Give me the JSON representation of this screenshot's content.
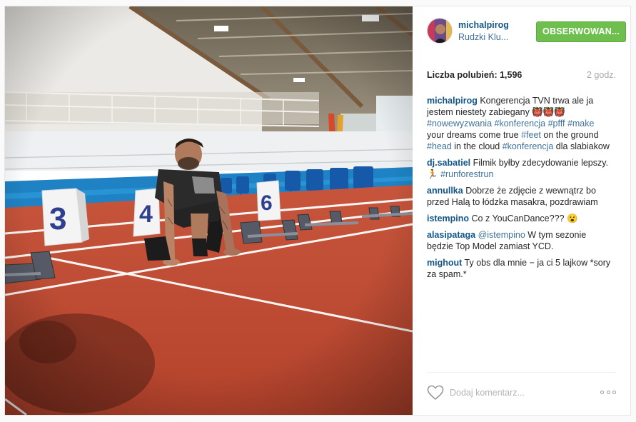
{
  "post": {
    "username": "michalpirog",
    "location": "Rudzki Klu...",
    "follow_label": "OBSERWOWAN...",
    "likes_label": "Liczba polubień:",
    "likes_count": "1,596",
    "time": "2 godz.",
    "comment_placeholder": "Dodaj komentarz...",
    "heart_icon": "heart-outline-icon",
    "more_icon": "ellipsis-icon"
  },
  "caption": {
    "user": "michalpirog",
    "text": "Kongerencja TVN trwa ale ja jestem niestety zabiegany 👹👹👹",
    "hashtags": [
      "#nowewyzwania",
      "#konferencja",
      "#pfff",
      "#make",
      "your",
      "dreams",
      "come",
      "true",
      "#feet",
      "on",
      "the",
      "ground",
      "#head",
      "in",
      "the",
      "cloud",
      "#konferencja",
      "dla",
      "slabiakow"
    ]
  },
  "comments": [
    {
      "user": "dj.sabatiel",
      "text": "Filmik byłby zdecydowanie lepszy. 🏃",
      "tag": "#runforestrun"
    },
    {
      "user": "annullka",
      "text": "Dobrze że zdjęcie z wewnątrz bo przed Halą to łódzka masakra, pozdrawiam"
    },
    {
      "user": "istempino",
      "text": "Co z YouCanDance??? 😮"
    },
    {
      "user": "alasipataga",
      "mention": "@istempino",
      "text": "W tym sezonie będzie Top Model zamiast YCD."
    },
    {
      "user": "mighout",
      "text": "Ty obs dla mnie − ja ci 5 lajkow *sory za spam.*"
    }
  ],
  "photo": {
    "lane_numbers": [
      "3",
      "4",
      "6"
    ]
  },
  "colors": {
    "username": "#125688",
    "hashtag": "#3f729b",
    "follow_bg": "#6fbf4f",
    "track": "#c24a33",
    "lane_line": "#ffffff",
    "wall_blue": "#1f82c4"
  }
}
